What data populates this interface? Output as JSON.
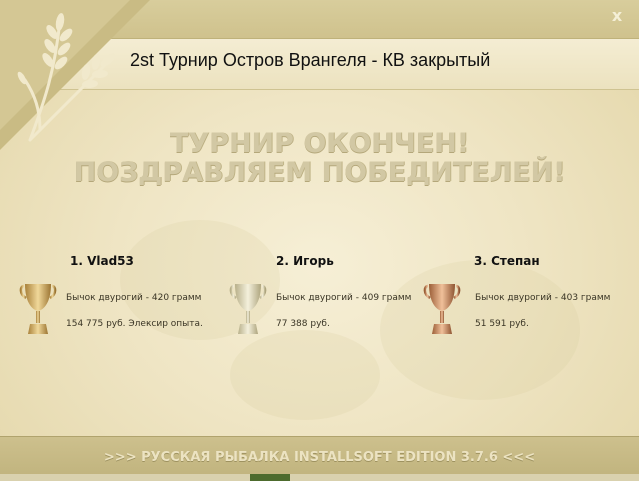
{
  "window": {
    "title": "2st Турнир Остров Врангеля - КВ закрытый",
    "close_label": "x"
  },
  "headline": {
    "line1": "ТУРНИР ОКОНЧЕН!",
    "line2": "ПОЗДРАВЛЯЕМ ПОБЕДИТЕЛЕЙ!"
  },
  "winners": [
    {
      "name": "1. Vlad53",
      "prize": "Бычок двурогий - 420 грамм",
      "reward": "154 775 руб. Элексир опыта.",
      "trophy": "gold-trophy-icon"
    },
    {
      "name": "2. Игорь",
      "prize": "Бычок двурогий - 409 грамм",
      "reward": "77 388 руб.",
      "trophy": "silver-trophy-icon"
    },
    {
      "name": "3. Степан",
      "prize": "Бычок двурогий - 403 грамм",
      "reward": "51 591 руб.",
      "trophy": "bronze-trophy-icon"
    }
  ],
  "footer": {
    "text": ">>> РУССКАЯ РЫБАЛКА INSTALLSOFT EDITION 3.7.6 <<<"
  },
  "colors": {
    "background": "#efe5c4",
    "headline": "#d2c8a4",
    "footer": "#c7ba86",
    "gold": "#d8b76a",
    "silver": "#d9d4b8",
    "bronze": "#c98f62"
  }
}
